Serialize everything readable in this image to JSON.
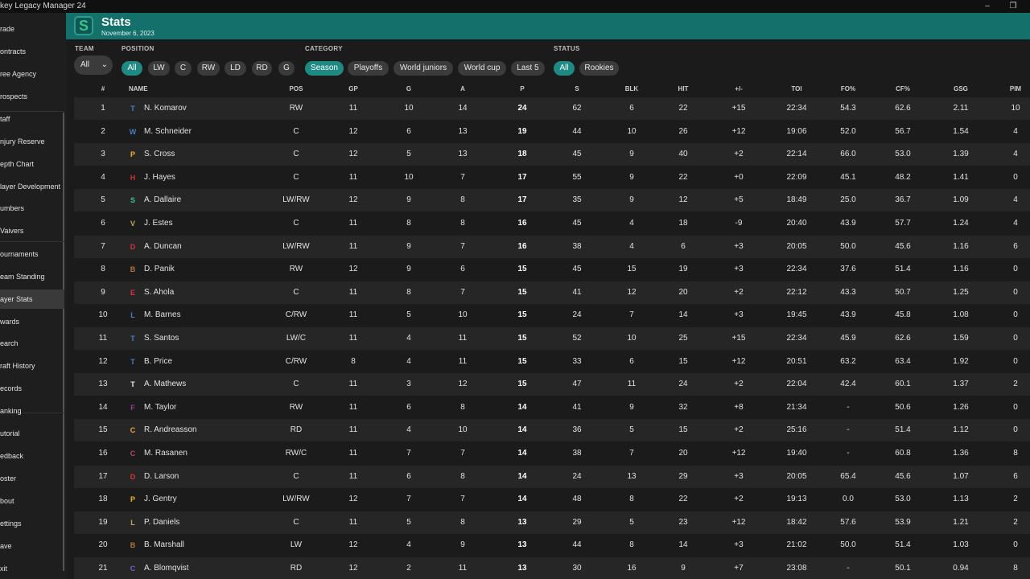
{
  "window": {
    "title": "key Legacy Manager 24",
    "min_icon": "minimize-icon",
    "restore_icon": "restore-icon"
  },
  "sidebar": {
    "items": [
      {
        "label": "rade"
      },
      {
        "label": "ontracts"
      },
      {
        "label": "ree Agency"
      },
      {
        "label": "rospects"
      },
      {
        "label": "taff"
      },
      {
        "label": "njury Reserve"
      },
      {
        "label": "epth Chart"
      },
      {
        "label": "layer Development"
      },
      {
        "label": "umbers"
      },
      {
        "label": "Vaivers"
      },
      {
        "label": "ournaments"
      },
      {
        "label": "eam Standing"
      },
      {
        "label": "ayer Stats"
      },
      {
        "label": "wards"
      },
      {
        "label": "earch"
      },
      {
        "label": "raft History"
      },
      {
        "label": "ecords"
      },
      {
        "label": "anking"
      },
      {
        "label": "utorial"
      },
      {
        "label": "edback"
      },
      {
        "label": "oster"
      },
      {
        "label": "bout"
      },
      {
        "label": "ettings"
      },
      {
        "label": "ave"
      },
      {
        "label": "xit"
      }
    ],
    "active_index": 12
  },
  "header": {
    "title": "Stats",
    "date": "November 6, 2023",
    "logo_icon": "team-s-logo-icon"
  },
  "filters": {
    "team_label": "TEAM",
    "team_value": "All",
    "position_label": "POSITION",
    "positions": [
      {
        "label": "All",
        "on": true
      },
      {
        "label": "LW"
      },
      {
        "label": "C"
      },
      {
        "label": "RW"
      },
      {
        "label": "LD"
      },
      {
        "label": "RD"
      },
      {
        "label": "G"
      }
    ],
    "category_label": "CATEGORY",
    "categories": [
      {
        "label": "Season",
        "on": true
      },
      {
        "label": "Playoffs"
      },
      {
        "label": "World juniors"
      },
      {
        "label": "World cup"
      },
      {
        "label": "Last 5"
      }
    ],
    "status_label": "STATUS",
    "statuses": [
      {
        "label": "All",
        "on": true
      },
      {
        "label": "Rookies"
      }
    ]
  },
  "table": {
    "columns": [
      "#",
      "NAME",
      "POS",
      "GP",
      "G",
      "A",
      "P",
      "S",
      "BLK",
      "HIT",
      "+/-",
      "TOI",
      "FO%",
      "CF%",
      "GSG",
      "PIM"
    ],
    "rows": [
      {
        "n": "1",
        "logo": "T",
        "color": "#4a7fc1",
        "name": "N. Komarov",
        "pos": "RW",
        "gp": "11",
        "g": "10",
        "a": "14",
        "p": "24",
        "s": "62",
        "blk": "6",
        "hit": "22",
        "pm": "+15",
        "toi": "22:34",
        "fo": "54.3",
        "cf": "62.6",
        "gsg": "2.11",
        "pim": "10"
      },
      {
        "n": "2",
        "logo": "W",
        "color": "#4a7fc1",
        "name": "M. Schneider",
        "pos": "C",
        "gp": "12",
        "g": "6",
        "a": "13",
        "p": "19",
        "s": "44",
        "blk": "10",
        "hit": "26",
        "pm": "+12",
        "toi": "19:06",
        "fo": "52.0",
        "cf": "56.7",
        "gsg": "1.54",
        "pim": "4"
      },
      {
        "n": "3",
        "logo": "P",
        "color": "#f2b01e",
        "name": "S. Cross",
        "pos": "C",
        "gp": "12",
        "g": "5",
        "a": "13",
        "p": "18",
        "s": "45",
        "blk": "9",
        "hit": "40",
        "pm": "+2",
        "toi": "22:14",
        "fo": "66.0",
        "cf": "53.0",
        "gsg": "1.39",
        "pim": "4"
      },
      {
        "n": "4",
        "logo": "H",
        "color": "#c8342e",
        "name": "J. Hayes",
        "pos": "C",
        "gp": "11",
        "g": "10",
        "a": "7",
        "p": "17",
        "s": "55",
        "blk": "9",
        "hit": "22",
        "pm": "+0",
        "toi": "22:09",
        "fo": "45.1",
        "cf": "48.2",
        "gsg": "1.41",
        "pim": "0"
      },
      {
        "n": "5",
        "logo": "S",
        "color": "#3cc08a",
        "name": "A. Dallaire",
        "pos": "LW/RW",
        "gp": "12",
        "g": "9",
        "a": "8",
        "p": "17",
        "s": "35",
        "blk": "9",
        "hit": "12",
        "pm": "+5",
        "toi": "18:49",
        "fo": "25.0",
        "cf": "36.7",
        "gsg": "1.09",
        "pim": "4"
      },
      {
        "n": "6",
        "logo": "V",
        "color": "#c9a55a",
        "name": "J. Estes",
        "pos": "C",
        "gp": "11",
        "g": "8",
        "a": "8",
        "p": "16",
        "s": "45",
        "blk": "4",
        "hit": "18",
        "pm": "-9",
        "toi": "20:40",
        "fo": "43.9",
        "cf": "57.7",
        "gsg": "1.24",
        "pim": "4"
      },
      {
        "n": "7",
        "logo": "D",
        "color": "#d8323a",
        "name": "A. Duncan",
        "pos": "LW/RW",
        "gp": "11",
        "g": "9",
        "a": "7",
        "p": "16",
        "s": "38",
        "blk": "4",
        "hit": "6",
        "pm": "+3",
        "toi": "20:05",
        "fo": "50.0",
        "cf": "45.6",
        "gsg": "1.16",
        "pim": "6"
      },
      {
        "n": "8",
        "logo": "B",
        "color": "#b7763a",
        "name": "D. Panik",
        "pos": "RW",
        "gp": "12",
        "g": "9",
        "a": "6",
        "p": "15",
        "s": "45",
        "blk": "15",
        "hit": "19",
        "pm": "+3",
        "toi": "22:34",
        "fo": "37.6",
        "cf": "51.4",
        "gsg": "1.16",
        "pim": "0"
      },
      {
        "n": "9",
        "logo": "E",
        "color": "#d8323a",
        "name": "S. Ahola",
        "pos": "C",
        "gp": "11",
        "g": "8",
        "a": "7",
        "p": "15",
        "s": "41",
        "blk": "12",
        "hit": "20",
        "pm": "+2",
        "toi": "22:12",
        "fo": "43.3",
        "cf": "50.7",
        "gsg": "1.25",
        "pim": "0"
      },
      {
        "n": "10",
        "logo": "L",
        "color": "#4a7fc1",
        "name": "M. Barnes",
        "pos": "C/RW",
        "gp": "11",
        "g": "5",
        "a": "10",
        "p": "15",
        "s": "24",
        "blk": "7",
        "hit": "14",
        "pm": "+3",
        "toi": "19:45",
        "fo": "43.9",
        "cf": "45.8",
        "gsg": "1.08",
        "pim": "0"
      },
      {
        "n": "11",
        "logo": "T",
        "color": "#4a7fc1",
        "name": "S. Santos",
        "pos": "LW/C",
        "gp": "11",
        "g": "4",
        "a": "11",
        "p": "15",
        "s": "52",
        "blk": "10",
        "hit": "25",
        "pm": "+15",
        "toi": "22:34",
        "fo": "45.9",
        "cf": "62.6",
        "gsg": "1.59",
        "pim": "0"
      },
      {
        "n": "12",
        "logo": "T",
        "color": "#4a7fc1",
        "name": "B. Price",
        "pos": "C/RW",
        "gp": "8",
        "g": "4",
        "a": "11",
        "p": "15",
        "s": "33",
        "blk": "6",
        "hit": "15",
        "pm": "+12",
        "toi": "20:51",
        "fo": "63.2",
        "cf": "63.4",
        "gsg": "1.92",
        "pim": "0"
      },
      {
        "n": "13",
        "logo": "T",
        "color": "#e8e8e8",
        "name": "A. Mathews",
        "pos": "C",
        "gp": "11",
        "g": "3",
        "a": "12",
        "p": "15",
        "s": "47",
        "blk": "11",
        "hit": "24",
        "pm": "+2",
        "toi": "22:04",
        "fo": "42.4",
        "cf": "60.1",
        "gsg": "1.37",
        "pim": "2"
      },
      {
        "n": "14",
        "logo": "F",
        "color": "#9a3a8e",
        "name": "M. Taylor",
        "pos": "RW",
        "gp": "11",
        "g": "6",
        "a": "8",
        "p": "14",
        "s": "41",
        "blk": "9",
        "hit": "32",
        "pm": "+8",
        "toi": "21:34",
        "fo": "-",
        "cf": "50.6",
        "gsg": "1.26",
        "pim": "0"
      },
      {
        "n": "15",
        "logo": "C",
        "color": "#f2a23a",
        "name": "R. Andreasson",
        "pos": "RD",
        "gp": "11",
        "g": "4",
        "a": "10",
        "p": "14",
        "s": "36",
        "blk": "5",
        "hit": "15",
        "pm": "+2",
        "toi": "25:16",
        "fo": "-",
        "cf": "51.4",
        "gsg": "1.12",
        "pim": "0"
      },
      {
        "n": "16",
        "logo": "C",
        "color": "#b2487a",
        "name": "M. Rasanen",
        "pos": "RW/C",
        "gp": "11",
        "g": "7",
        "a": "7",
        "p": "14",
        "s": "38",
        "blk": "7",
        "hit": "20",
        "pm": "+12",
        "toi": "19:40",
        "fo": "-",
        "cf": "60.8",
        "gsg": "1.36",
        "pim": "8"
      },
      {
        "n": "17",
        "logo": "D",
        "color": "#d8323a",
        "name": "D. Larson",
        "pos": "C",
        "gp": "11",
        "g": "6",
        "a": "8",
        "p": "14",
        "s": "24",
        "blk": "13",
        "hit": "29",
        "pm": "+3",
        "toi": "20:05",
        "fo": "65.4",
        "cf": "45.6",
        "gsg": "1.07",
        "pim": "6"
      },
      {
        "n": "18",
        "logo": "P",
        "color": "#f2b01e",
        "name": "J. Gentry",
        "pos": "LW/RW",
        "gp": "12",
        "g": "7",
        "a": "7",
        "p": "14",
        "s": "48",
        "blk": "8",
        "hit": "22",
        "pm": "+2",
        "toi": "19:13",
        "fo": "0.0",
        "cf": "53.0",
        "gsg": "1.13",
        "pim": "2"
      },
      {
        "n": "19",
        "logo": "L",
        "color": "#c9a55a",
        "name": "P. Daniels",
        "pos": "C",
        "gp": "11",
        "g": "5",
        "a": "8",
        "p": "13",
        "s": "29",
        "blk": "5",
        "hit": "23",
        "pm": "+12",
        "toi": "18:42",
        "fo": "57.6",
        "cf": "53.9",
        "gsg": "1.21",
        "pim": "2"
      },
      {
        "n": "20",
        "logo": "B",
        "color": "#b7763a",
        "name": "B. Marshall",
        "pos": "LW",
        "gp": "12",
        "g": "4",
        "a": "9",
        "p": "13",
        "s": "44",
        "blk": "8",
        "hit": "14",
        "pm": "+3",
        "toi": "21:02",
        "fo": "50.0",
        "cf": "51.4",
        "gsg": "1.03",
        "pim": "0"
      },
      {
        "n": "21",
        "logo": "C",
        "color": "#7a5ac8",
        "name": "A. Blomqvist",
        "pos": "RD",
        "gp": "12",
        "g": "2",
        "a": "11",
        "p": "13",
        "s": "30",
        "blk": "16",
        "hit": "9",
        "pm": "+7",
        "toi": "23:08",
        "fo": "-",
        "cf": "50.1",
        "gsg": "0.94",
        "pim": "8"
      }
    ]
  }
}
